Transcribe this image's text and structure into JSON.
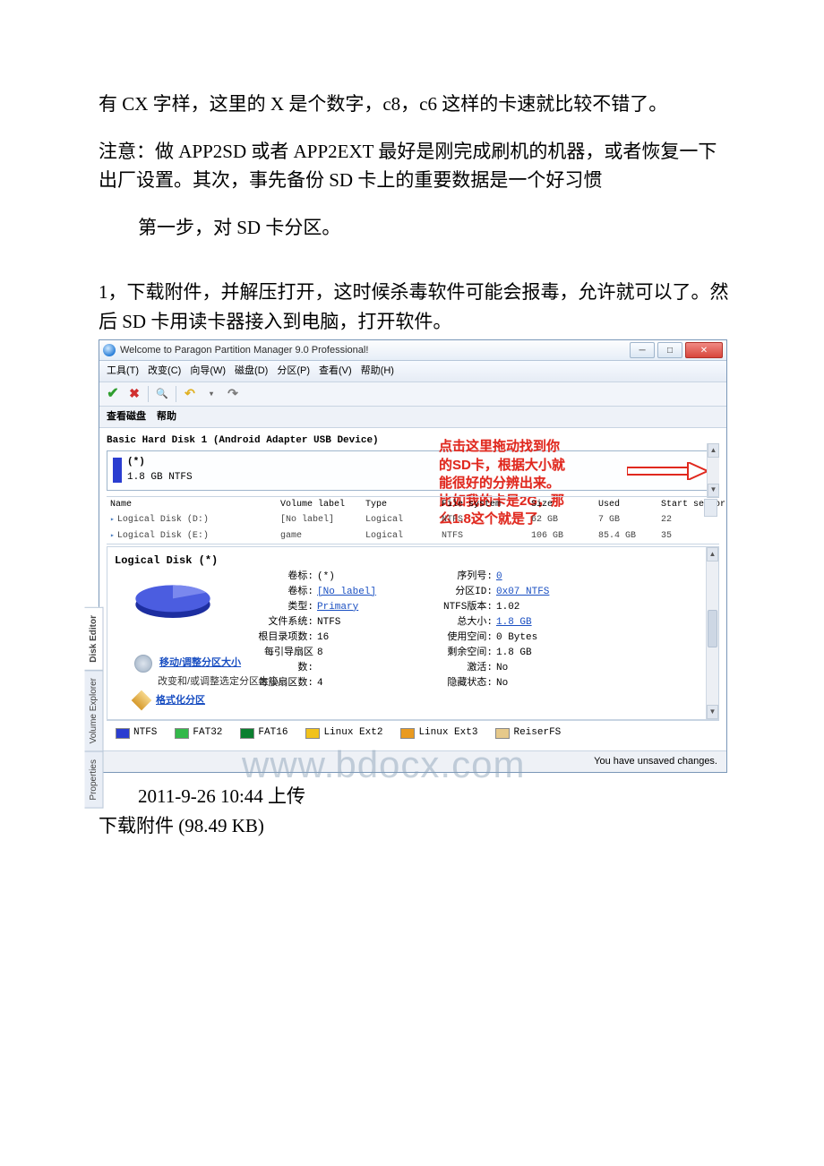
{
  "doc": {
    "p1": "有 CX 字样，这里的 X 是个数字，c8，c6 这样的卡速就比较不错了。",
    "p2": "注意：做 APP2SD 或者 APP2EXT 最好是刚完成刷机的机器，或者恢复一下出厂设置。其次，事先备份 SD 卡上的重要数据是一个好习惯",
    "step_title": "第一步，对 SD 卡分区。",
    "p3": "1，下载附件，并解压打开，这时候杀毒软件可能会报毒，允许就可以了。然后 SD 卡用读卡器接入到电脑，打开软件。",
    "upload_time": "2011-9-26 10:44 上传",
    "download_label": "下载附件 (98.49 KB)"
  },
  "watermark": "www.bdocx.com",
  "window": {
    "title": "Welcome to Paragon Partition Manager 9.0 Professional!",
    "menus": {
      "tools": "工具(T)",
      "change": "改变(C)",
      "wizard": "向导(W)",
      "disk": "磁盘(D)",
      "partition": "分区(P)",
      "view": "查看(V)",
      "help": "帮助(H)"
    },
    "subtb_view": "查看磁盘",
    "subtb_help": "帮助",
    "disk_header": "Basic Hard Disk 1 (Android Adapter USB Device)",
    "disk_label_star": "(*)",
    "disk_label_size": "1.8 GB NTFS",
    "cols": {
      "name": "Name",
      "vol": "Volume label",
      "type": "Type",
      "fs": "File system",
      "size": "Size",
      "used": "Used",
      "start": "Start sector"
    },
    "rows": [
      {
        "name": "Logical Disk (D:)",
        "vol": "[No label]",
        "type": "Logical",
        "fs": "NTFS",
        "size": "62 GB",
        "used": "7 GB",
        "start": "22"
      },
      {
        "name": "Logical Disk (E:)",
        "vol": "game",
        "type": "Logical",
        "fs": "NTFS",
        "size": "106 GB",
        "used": "85.4 GB",
        "start": "35"
      }
    ],
    "detail_title": "Logical Disk (*)",
    "props_left": [
      {
        "k": "卷标:",
        "v": "(*)",
        "link": false
      },
      {
        "k": "卷标:",
        "v": "[No label]",
        "link": true
      },
      {
        "k": "类型:",
        "v": "Primary",
        "link": true
      },
      {
        "k": "文件系统:",
        "v": "NTFS",
        "link": false
      },
      {
        "k": "根目录项数:",
        "v": "16",
        "link": false
      },
      {
        "k": "每引导扇区数:",
        "v": "8",
        "link": false
      },
      {
        "k": "每簇扇区数:",
        "v": "4",
        "link": false
      }
    ],
    "props_right": [
      {
        "k": "序列号:",
        "v": "0",
        "link": true
      },
      {
        "k": "分区ID:",
        "v": "0x07 NTFS",
        "link": true
      },
      {
        "k": "NTFS版本:",
        "v": "1.02",
        "link": false
      },
      {
        "k": "总大小:",
        "v": "1.8 GB",
        "link": true
      },
      {
        "k": "使用空间:",
        "v": "0 Bytes",
        "link": false
      },
      {
        "k": "剩余空间:",
        "v": "1.8 GB",
        "link": false
      },
      {
        "k": "激活:",
        "v": "No",
        "link": false
      },
      {
        "k": "隐藏状态:",
        "v": "No",
        "link": false
      }
    ],
    "action1_title": "移动/调整分区大小",
    "action1_sub": "改变和/或调整选定分区大小。",
    "action2_title": "格式化分区",
    "legend": [
      {
        "label": "NTFS",
        "color": "#2a3dd0"
      },
      {
        "label": "FAT32",
        "color": "#33b84a"
      },
      {
        "label": "FAT16",
        "color": "#0b7f2f"
      },
      {
        "label": "Linux Ext2",
        "color": "#f1c21b"
      },
      {
        "label": "Linux Ext3",
        "color": "#e99a1f"
      },
      {
        "label": "ReiserFS",
        "color": "#e6c98a"
      }
    ],
    "status": "You have unsaved changes.",
    "side_tabs": [
      "Disk Editor",
      "Volume Explorer",
      "Properties"
    ]
  },
  "annotation": {
    "l1": "点击这里拖动找到你",
    "l2": "的SD卡，根据大小就",
    "l3": "能很好的分辨出来。",
    "l4": "比如我的卡是2G，那",
    "l5": "么1.8这个就是了"
  }
}
